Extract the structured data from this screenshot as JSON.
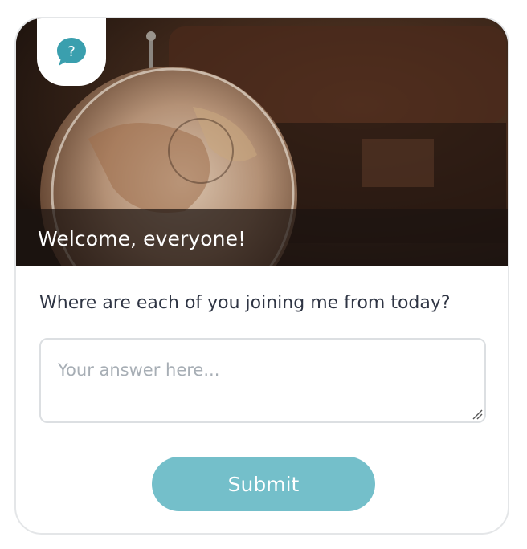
{
  "header": {
    "badge_icon": "speech-bubble-question-icon",
    "badge_color": "#3a9fae",
    "welcome_text": "Welcome, everyone!",
    "hero_image": "antique-globe-photo"
  },
  "form": {
    "question": "Where are each of you joining me from today?",
    "answer_placeholder": "Your answer here...",
    "answer_value": "",
    "submit_label": "Submit",
    "accent_color": "#74bfca"
  }
}
